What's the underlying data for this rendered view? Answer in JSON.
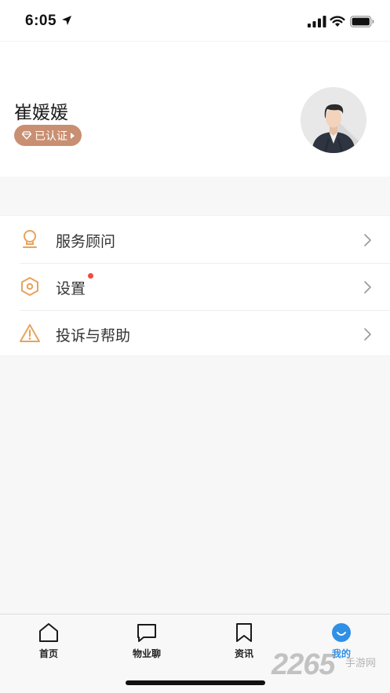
{
  "status_bar": {
    "time": "6:05",
    "icons": [
      "location-arrow-icon",
      "signal-icon",
      "wifi-icon",
      "battery-icon"
    ]
  },
  "profile": {
    "name": "崔媛媛",
    "badge": "已认证",
    "avatar": "user-avatar"
  },
  "menu": {
    "items": [
      {
        "label": "服务顾问",
        "icon": "advisor-icon",
        "has_dot": false
      },
      {
        "label": "设置",
        "icon": "settings-hex-icon",
        "has_dot": true
      },
      {
        "label": "投诉与帮助",
        "icon": "warning-icon",
        "has_dot": false
      }
    ]
  },
  "tab_bar": {
    "tabs": [
      {
        "label": "首页",
        "icon": "home-icon",
        "active": false
      },
      {
        "label": "物业聊",
        "icon": "chat-icon",
        "active": false
      },
      {
        "label": "资讯",
        "icon": "bookmark-icon",
        "active": false
      },
      {
        "label": "我的",
        "icon": "smile-icon",
        "active": true
      }
    ]
  },
  "watermark": {
    "number": "2265",
    "text": "手游网"
  },
  "colors": {
    "accent": "#e8a35c",
    "badge": "#c98f72",
    "active_tab": "#2f90e6",
    "notification_dot": "#ef4b3f"
  }
}
